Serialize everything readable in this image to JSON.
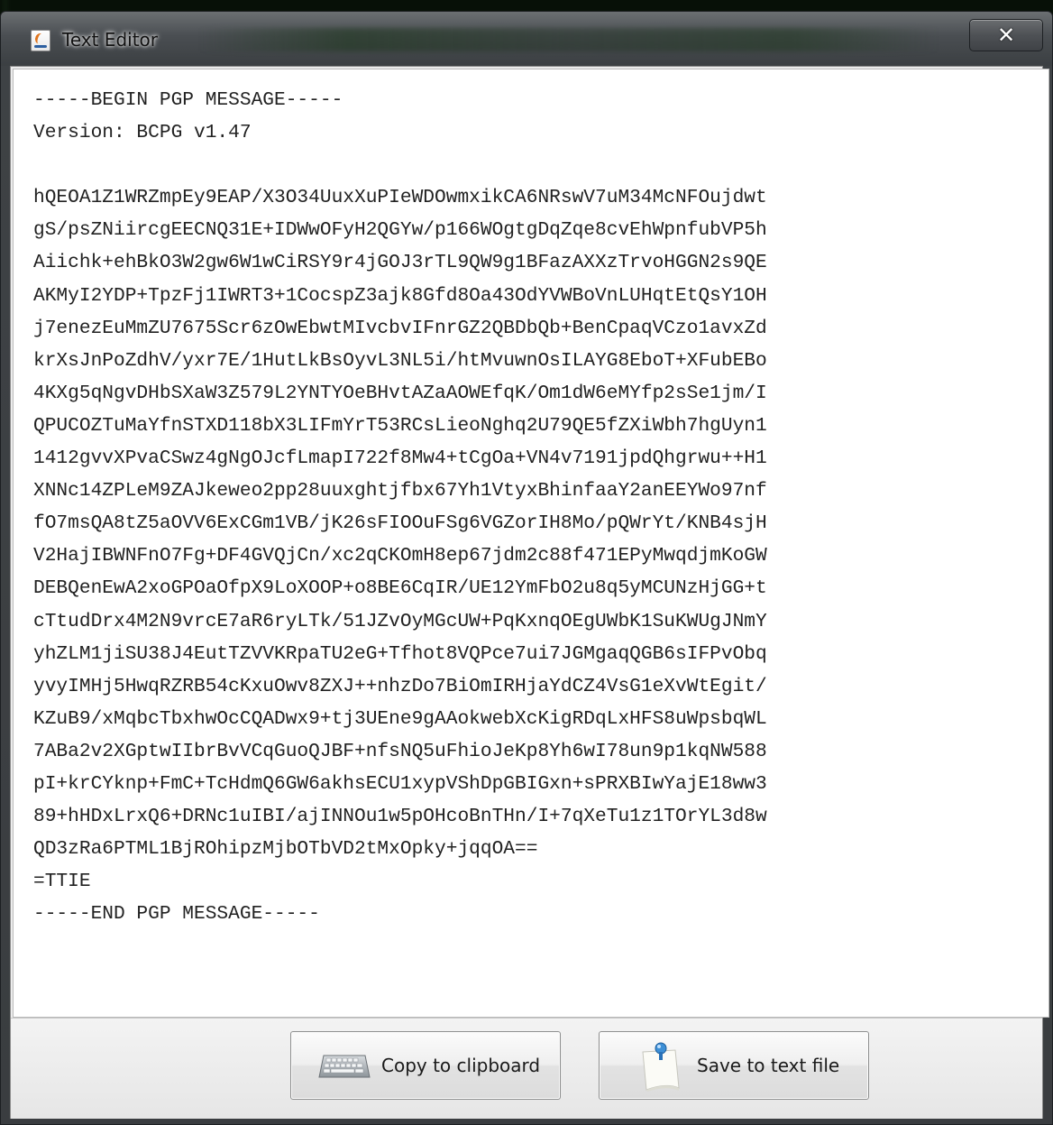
{
  "window": {
    "title": "Text Editor",
    "close_glyph": "✕"
  },
  "editor": {
    "content": "-----BEGIN PGP MESSAGE-----\nVersion: BCPG v1.47\n\nhQEOA1Z1WRZmpEy9EAP/X3O34UuxXuPIeWDOwmxikCA6NRswV7uM34McNFOujdwt\ngS/psZNiircgEECNQ31E+IDWwOFyH2QGYw/p166WOgtgDqZqe8cvEhWpnfubVP5h\nAiichk+ehBkO3W2gw6W1wCiRSY9r4jGOJ3rTL9QW9g1BFazAXXzTrvoHGGN2s9QE\nAKMyI2YDP+TpzFj1IWRT3+1CocspZ3ajk8Gfd8Oa43OdYVWBoVnLUHqtEtQsY1OH\nj7enezEuMmZU7675Scr6zOwEbwtMIvcbvIFnrGZ2QBDbQb+BenCpaqVCzo1avxZd\nkrXsJnPoZdhV/yxr7E/1HutLkBsOyvL3NL5i/htMvuwnOsILAYG8EboT+XFubEBo\n4KXg5qNgvDHbSXaW3Z579L2YNTYOeBHvtAZaAOWEfqK/Om1dW6eMYfp2sSe1jm/I\nQPUCOZTuMaYfnSTXD118bX3LIFmYrT53RCsLieoNghq2U79QE5fZXiWbh7hgUyn1\n1412gvvXPvaCSwz4gNgOJcfLmapI722f8Mw4+tCgOa+VN4v7191jpdQhgrwu++H1\nXNNc14ZPLeM9ZAJkeweo2pp28uuxghtjfbx67Yh1VtyxBhinfaaY2anEEYWo97nf\nfO7msQA8tZ5aOVV6ExCGm1VB/jK26sFIOOuFSg6VGZorIH8Mo/pQWrYt/KNB4sjH\nV2HajIBWNFnO7Fg+DF4GVQjCn/xc2qCKOmH8ep67jdm2c88f471EPyMwqdjmKoGW\nDEBQenEwA2xoGPOaOfpX9LoXOOP+o8BE6CqIR/UE12YmFbO2u8q5yMCUNzHjGG+t\ncTtudDrx4M2N9vrcE7aR6ryLTk/51JZvOyMGcUW+PqKxnqOEgUWbK1SuKWUgJNmY\nyhZLM1jiSU38J4EutTZVVKRpaTU2eG+Tfhot8VQPce7ui7JGMgaqQGB6sIFPvObq\nyvyIMHj5HwqRZRB54cKxuOwv8ZXJ++nhzDo7BiOmIRHjaYdCZ4VsG1eXvWtEgit/\nKZuB9/xMqbcTbxhwOcCQADwx9+tj3UEne9gAAokwebXcKigRDqLxHFS8uWpsbqWL\n7ABa2v2XGptwIIbrBvVCqGuoQJBF+nfsNQ5uFhioJeKp8Yh6wI78un9p1kqNW588\npI+krCYknp+FmC+TcHdmQ6GW6akhsECU1xypVShDpGBIGxn+sPRXBIwYajE18ww3\n89+hHDxLrxQ6+DRNc1uIBI/ajINNOu1w5pOHcoBnTHn/I+7qXeTu1z1TOrYL3d8w\nQD3zRa6PTML1BjROhipzMjbOTbVD2tMxOpky+jqqOA==\n=TTIE\n-----END PGP MESSAGE-----"
  },
  "buttons": {
    "copy_label": "Copy to clipboard",
    "copy_icon": "keyboard-icon",
    "save_label": "Save to text file",
    "save_icon": "sticky-note-icon"
  }
}
